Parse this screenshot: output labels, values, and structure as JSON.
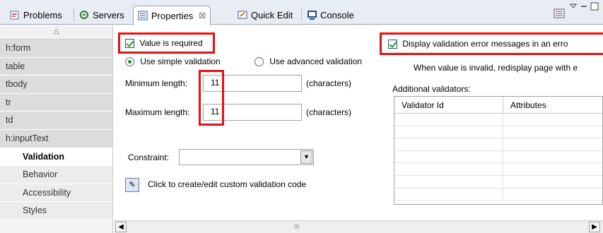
{
  "tabs": [
    {
      "label": "Problems",
      "icon": "problems-icon"
    },
    {
      "label": "Servers",
      "icon": "servers-icon"
    },
    {
      "label": "Properties",
      "icon": "properties-icon",
      "active": true
    },
    {
      "label": "Quick Edit",
      "icon": "quick-edit-icon"
    },
    {
      "label": "Console",
      "icon": "console-icon"
    }
  ],
  "tab_close": "☒",
  "nav_items": [
    {
      "label": "h:form"
    },
    {
      "label": "table"
    },
    {
      "label": "tbody"
    },
    {
      "label": "tr"
    },
    {
      "label": "td"
    },
    {
      "label": "h:inputText"
    },
    {
      "label": "Validation",
      "selected": true
    },
    {
      "label": "Behavior"
    },
    {
      "label": "Accessibility"
    },
    {
      "label": "Styles"
    }
  ],
  "validation": {
    "value_required": "Value is required",
    "simple_validation": "Use simple validation",
    "advanced_validation": "Use advanced validation",
    "min_length_label": "Minimum length:",
    "min_length_value": "11",
    "max_length_label": "Maximum length:",
    "max_length_value": "11",
    "units": "(characters)",
    "constraint_label": "Constraint:",
    "constraint_value": "",
    "custom_code": "Click to create/edit custom validation code"
  },
  "right_panel": {
    "display_errors": "Display validation error messages in an erro",
    "redisplay_text": "When value is invalid, redisplay page with e",
    "additional_validators": "Additional validators:",
    "columns": [
      "Validator Id",
      "Attributes"
    ]
  },
  "scroll_grip": "III",
  "colors": {
    "highlight": "#e81010",
    "tab_bg": "#e8ecf3"
  }
}
